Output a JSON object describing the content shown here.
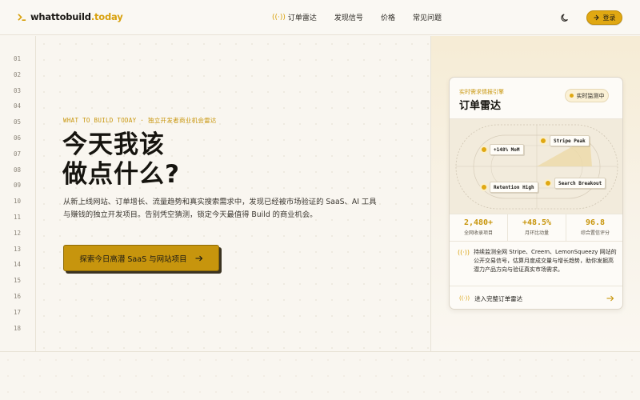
{
  "header": {
    "logo_prefix": "whattobuild",
    "logo_dot": ".",
    "logo_suffix": "today",
    "nav": [
      {
        "label": "订单雷达",
        "icon": "radar-icon"
      },
      {
        "label": "发现信号"
      },
      {
        "label": "价格"
      },
      {
        "label": "常见问题"
      }
    ],
    "theme_icon": "moon-icon",
    "login_label": "登录",
    "login_icon": "login-icon"
  },
  "gutter": {
    "line_numbers": [
      "01",
      "02",
      "03",
      "04",
      "05",
      "06",
      "07",
      "08",
      "09",
      "10",
      "11",
      "12",
      "13",
      "14",
      "15",
      "16",
      "17",
      "18"
    ]
  },
  "hero": {
    "eyebrow": "WHAT TO BUILD TODAY · 独立开发者商业机会雷达",
    "headline_line1": "今天我该",
    "headline_line2": "做点什么?",
    "description": "从新上线网站、订单增长、流量趋势和真实搜索需求中，发现已经被市场验证的 SaaS、AI 工具与赚钱的独立开发项目。告别凭空猜测，锁定今天最值得 Build 的商业机会。",
    "cta_label": "探索今日高潜 SaaS 与网站项目",
    "cta_icon": "arrow-right-icon"
  },
  "card": {
    "eyebrow": "实时需求情报引擎",
    "title": "订单雷达",
    "live_badge": "实时监测中",
    "radar_tags": [
      {
        "label": "+148% MoM"
      },
      {
        "label": "Stripe Peak"
      },
      {
        "label": "Retention High"
      },
      {
        "label": "Search Breakout"
      }
    ],
    "stats": [
      {
        "value": "2,480+",
        "label": "全网收录项目"
      },
      {
        "value": "+48.5%",
        "label": "月环比动量"
      },
      {
        "value": "96.8",
        "label": "综合置信评分"
      }
    ],
    "description": "持续监测全网 Stripe、Creem、LemonSqueezy 网站的公开交易信号，估算月度成交量与增长趋势，助你发掘高潜力产品方向与验证真实市场需求。",
    "description_icon": "signal-icon",
    "footer_label": "进入完整订单雷达",
    "footer_icon": "signal-icon",
    "footer_arrow": "arrow-right-icon"
  },
  "colors": {
    "accent": "#e0a812",
    "accent_dark": "#c8950b",
    "background": "#f9f6f0",
    "text": "#1c1a16"
  }
}
